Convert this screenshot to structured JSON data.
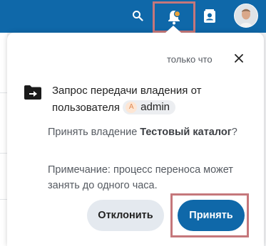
{
  "colors": {
    "header_bg": "#0f68a9",
    "primary_button": "#0f68a9",
    "secondary_button": "#e4e9ef",
    "highlight_frame": "#c5777b",
    "notification_dot": "#e9a23b"
  },
  "header": {
    "icons": [
      "search-icon",
      "bell-icon",
      "contacts-icon",
      "avatar"
    ]
  },
  "notification": {
    "timestamp": "только что",
    "title_before": "Запрос передачи владения от пользователя",
    "user_initial": "A",
    "user_name": "admin",
    "question_prefix": "Принять владение",
    "folder_name": "Тестовый каталог",
    "question_suffix": "?",
    "note": "Примечание: процесс переноса может занять до одного часа.",
    "decline_label": "Отклонить",
    "accept_label": "Принять"
  }
}
